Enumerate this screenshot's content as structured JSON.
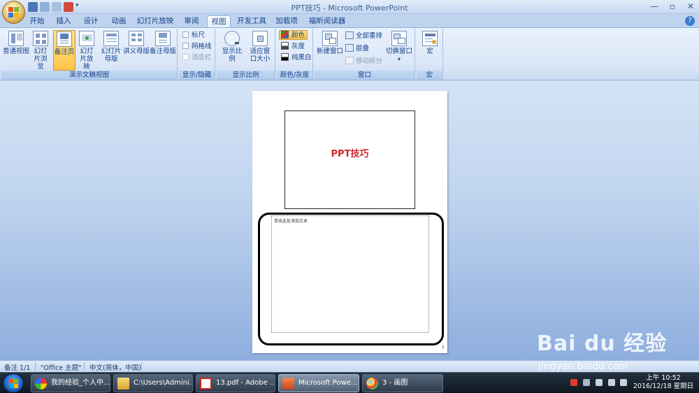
{
  "window": {
    "title": "PPT技巧 - Microsoft PowerPoint",
    "controls": [
      "—",
      "▫",
      "✕"
    ]
  },
  "tabs": [
    {
      "label": "开始"
    },
    {
      "label": "插入"
    },
    {
      "label": "设计"
    },
    {
      "label": "动画"
    },
    {
      "label": "幻灯片放映"
    },
    {
      "label": "审阅"
    },
    {
      "label": "视图",
      "active": true
    },
    {
      "label": "开发工具"
    },
    {
      "label": "加载项"
    },
    {
      "label": "福昕阅读器"
    }
  ],
  "ribbon": {
    "views": {
      "label": "演示文稿视图",
      "buttons": {
        "normal": "普通视图",
        "sorter": "幻灯片浏览",
        "notes": "备注页",
        "show": "幻灯片放映",
        "slide_master": "幻灯片母版",
        "handout_master": "讲义母版",
        "notes_master": "备注母版"
      }
    },
    "show_hide": {
      "label": "显示/隐藏",
      "ruler": "标尺",
      "gridlines": "网格线",
      "message_bar": "消息栏"
    },
    "zoom": {
      "label": "显示比例",
      "zoom": "显示比例",
      "fit": "适应窗口大小"
    },
    "color": {
      "label": "颜色/灰度",
      "color": "颜色",
      "grayscale": "灰度",
      "pure_bw": "纯黑白"
    },
    "window": {
      "label": "窗口",
      "new_window": "新建窗口",
      "arrange_all": "全部重排",
      "cascade": "层叠",
      "move_split": "移动拆分",
      "switch_windows": "切换窗口"
    },
    "macros": {
      "label": "宏",
      "macros": "宏"
    }
  },
  "document": {
    "slide_title": "PPT技巧",
    "notes_placeholder": "单击此处添加文本",
    "page_number": "1"
  },
  "status": {
    "page": "备注 1/1",
    "theme": "\"Office 主题\"",
    "language": "中文(简体，中国)"
  },
  "taskbar": {
    "items": [
      {
        "label": "我的经验_个人中..."
      },
      {
        "label": "C:\\Users\\Admini..."
      },
      {
        "label": "13.pdf - Adobe ..."
      },
      {
        "label": "Microsoft Powe...",
        "active": true
      },
      {
        "label": "3 - 画图"
      }
    ],
    "clock_time": "上午 10:52",
    "clock_date": "2016/12/18 星期日"
  },
  "watermark": {
    "text": "Bai du 经验",
    "sub": "jingyan.baidu.com"
  },
  "colors": {
    "accent": "#15428b",
    "slide_title": "#d0262d",
    "taskbar": "#1b2633"
  }
}
